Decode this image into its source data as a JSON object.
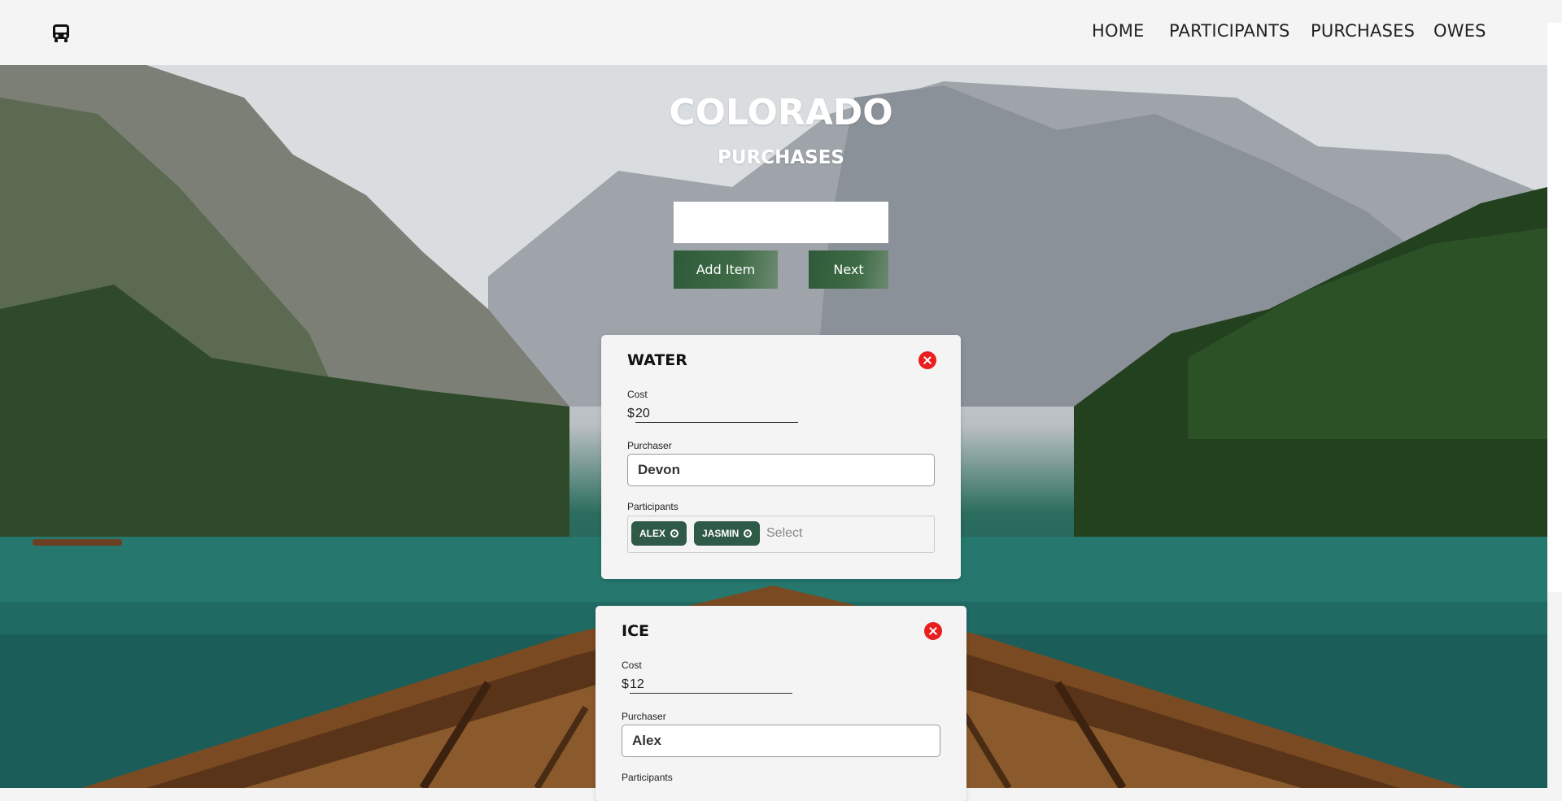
{
  "nav": {
    "links": [
      "HOME",
      "PARTICIPANTS",
      "PURCHASES",
      "OWES"
    ],
    "logo_icon": "bus-icon"
  },
  "hero": {
    "title": "COLORADO",
    "subtitle": "PURCHASES"
  },
  "controls": {
    "item_input_value": "",
    "add_label": "Add Item",
    "next_label": "Next"
  },
  "purchases": [
    {
      "name": "WATER",
      "cost_label": "Cost",
      "currency": "$",
      "cost": "20",
      "purchaser_label": "Purchaser",
      "purchaser": "Devon",
      "participants_label": "Participants",
      "participants": [
        "ALEX",
        "JASMIN"
      ],
      "select_placeholder": "Select"
    },
    {
      "name": "ICE",
      "cost_label": "Cost",
      "currency": "$",
      "cost": "12",
      "purchaser_label": "Purchaser",
      "purchaser": "Alex",
      "participants_label": "Participants"
    }
  ],
  "colors": {
    "accent_green": "#2f5a48",
    "close_red": "#e81f1f"
  }
}
